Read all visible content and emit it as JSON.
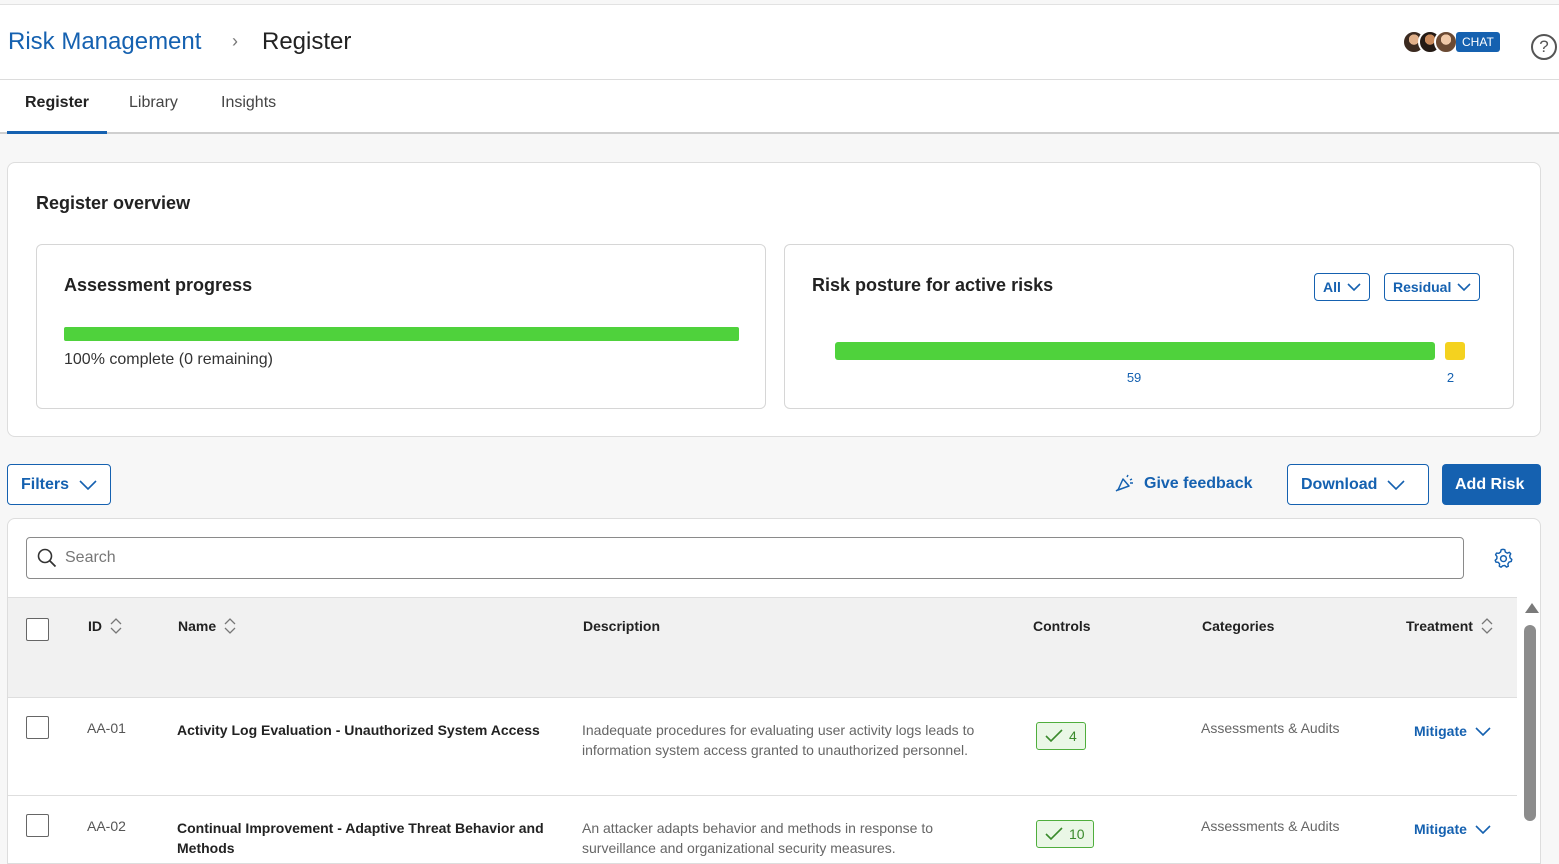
{
  "breadcrumb": {
    "root": "Risk Management",
    "separator": "›",
    "current": "Register"
  },
  "header": {
    "chat_label": "CHAT",
    "help_label": "?"
  },
  "tabs": [
    {
      "label": "Register",
      "active": true
    },
    {
      "label": "Library",
      "active": false
    },
    {
      "label": "Insights",
      "active": false
    }
  ],
  "overview": {
    "title": "Register overview",
    "assessment": {
      "title": "Assessment progress",
      "progress": 1.0,
      "status_text": "100% complete (0 remaining)"
    },
    "posture": {
      "title": "Risk posture for active risks",
      "filter_all": "All",
      "filter_residual": "Residual",
      "segments": [
        {
          "value": 59,
          "label": "59",
          "color": "#4fd23c"
        },
        {
          "value": 2,
          "label": "2",
          "color": "#f4d21f"
        }
      ]
    }
  },
  "toolbar": {
    "filters_label": "Filters",
    "feedback_label": "Give feedback",
    "download_label": "Download",
    "add_label": "Add Risk"
  },
  "search": {
    "placeholder": "Search",
    "value": ""
  },
  "table": {
    "columns": {
      "id": "ID",
      "name": "Name",
      "description": "Description",
      "controls": "Controls",
      "categories": "Categories",
      "treatment": "Treatment"
    },
    "rows": [
      {
        "id": "AA-01",
        "name": "Activity Log Evaluation - Unauthorized System Access",
        "description": "Inadequate procedures for evaluating user activity logs leads to information system access granted to unauthorized personnel.",
        "controls": "4",
        "categories": "Assessments & Audits",
        "treatment": "Mitigate"
      },
      {
        "id": "AA-02",
        "name": "Continual Improvement - Adaptive Threat Behavior and Methods",
        "description": "An attacker adapts behavior and methods in response to surveillance and organizational security measures.",
        "controls": "10",
        "categories": "Assessments & Audits",
        "treatment": "Mitigate"
      }
    ]
  },
  "colors": {
    "accent": "#1561b0",
    "success": "#4fd23c",
    "warning": "#f4d21f"
  }
}
